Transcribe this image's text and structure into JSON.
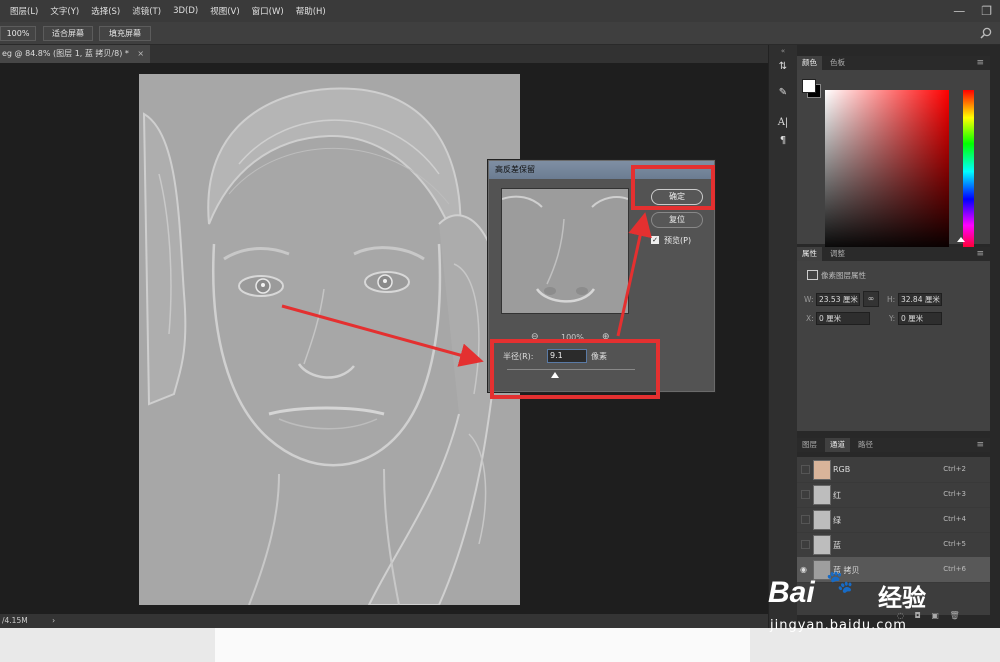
{
  "menu": [
    "图层(L)",
    "文字(Y)",
    "选择(S)",
    "滤镜(T)",
    "3D(D)",
    "视图(V)",
    "窗口(W)",
    "帮助(H)"
  ],
  "options": {
    "zoom": "100%",
    "fit_screen": "适合屏幕",
    "fill_screen": "填充屏幕"
  },
  "doc_tab": {
    "title": "eg @ 84.8% (图层 1, 蓝 拷贝/8) *",
    "close": "×"
  },
  "status": {
    "size": "/4.15M",
    "arrow": "›"
  },
  "color_panel": {
    "tabs": [
      "颜色",
      "色板"
    ],
    "fg_color": "#ffffff",
    "bg_color": "#000000"
  },
  "properties_panel": {
    "tabs": [
      "属性",
      "调整"
    ],
    "subtitle": "像素图层属性",
    "w_label": "W:",
    "w_value": "23.53 厘米",
    "h_label": "H:",
    "h_value": "32.84 厘米",
    "x_label": "X:",
    "x_value": "0 厘米",
    "y_label": "Y:",
    "y_value": "0 厘米"
  },
  "channels_panel": {
    "tabs": [
      "图层",
      "通道",
      "路径"
    ],
    "rows": [
      {
        "name": "RGB",
        "shortcut": "Ctrl+2"
      },
      {
        "name": "红",
        "shortcut": "Ctrl+3"
      },
      {
        "name": "绿",
        "shortcut": "Ctrl+4"
      },
      {
        "name": "蓝",
        "shortcut": "Ctrl+5"
      },
      {
        "name": "蓝 拷贝",
        "shortcut": "Ctrl+6"
      }
    ]
  },
  "dialog": {
    "title": "高反差保留",
    "ok": "确定",
    "reset": "复位",
    "preview_label": "预览(P)",
    "zoom": "100%",
    "radius_label": "半径(R):",
    "radius_value": "9.1",
    "unit": "像素"
  },
  "watermark": {
    "brand": "Bai",
    "brand2": "经验",
    "url": "jingyan.baidu.com"
  },
  "annotation_color": "#e43030"
}
